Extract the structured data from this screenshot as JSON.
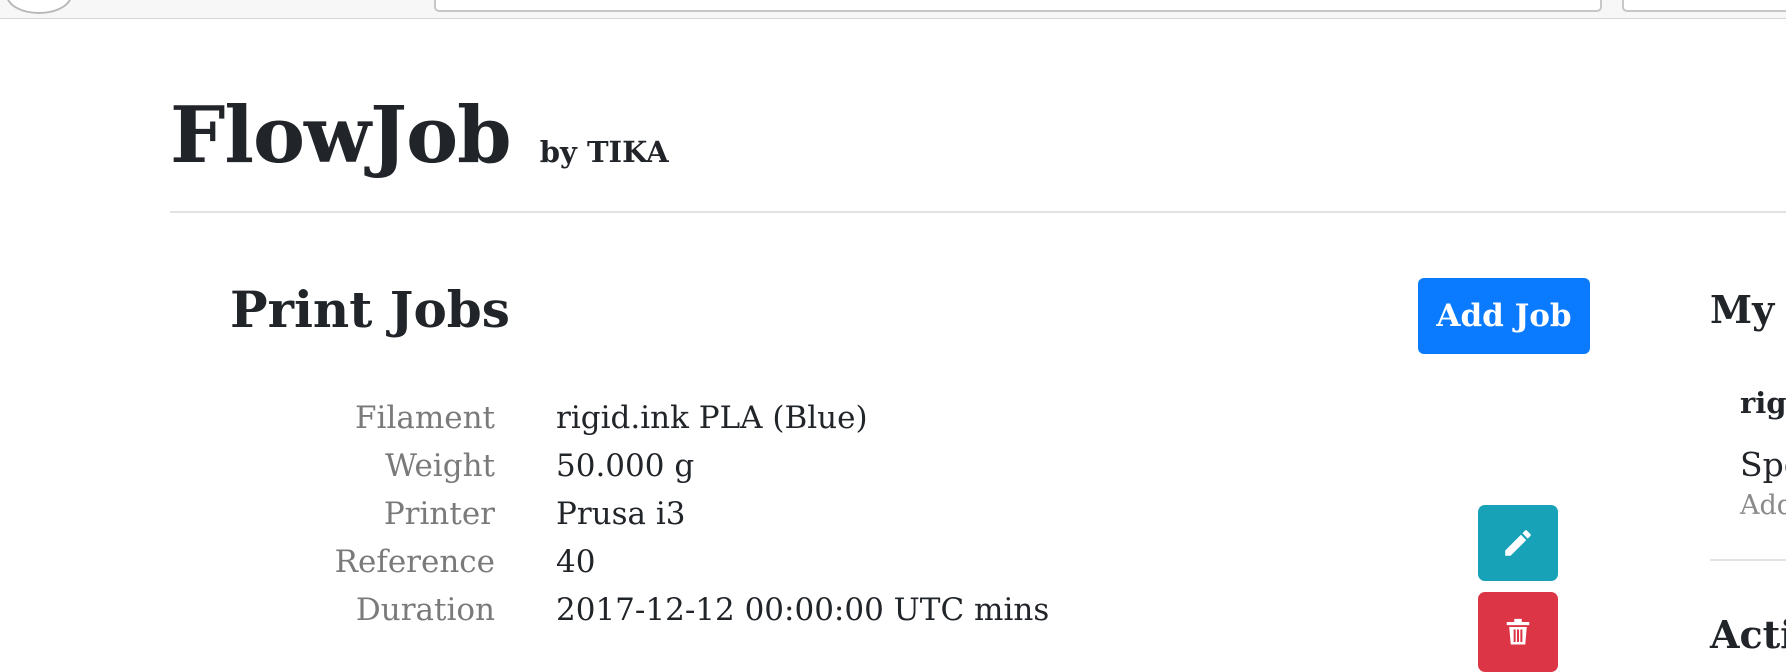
{
  "brand": {
    "title": "FlowJob",
    "subtitle": "by TIKA"
  },
  "print_jobs": {
    "title": "Print Jobs",
    "add_button_label": "Add Job",
    "fields": [
      {
        "label": "Filament",
        "value": "rigid.ink PLA (Blue)"
      },
      {
        "label": "Weight",
        "value": "50.000 g"
      },
      {
        "label": "Printer",
        "value": "Prusa i3"
      },
      {
        "label": "Reference",
        "value": "40"
      },
      {
        "label": "Duration",
        "value": "2017-12-12 00:00:00 UTC mins"
      }
    ],
    "actions": {
      "edit_icon": "pencil-icon",
      "delete_icon": "trash-icon"
    }
  },
  "sidebar": {
    "title": "My I",
    "item_title": "rigi",
    "item_subtitle": "Spo",
    "item_link": "Add",
    "section2_title": "Activ"
  },
  "colors": {
    "primary": "#0a7bff",
    "info": "#17a2b8",
    "danger": "#dc3545"
  }
}
